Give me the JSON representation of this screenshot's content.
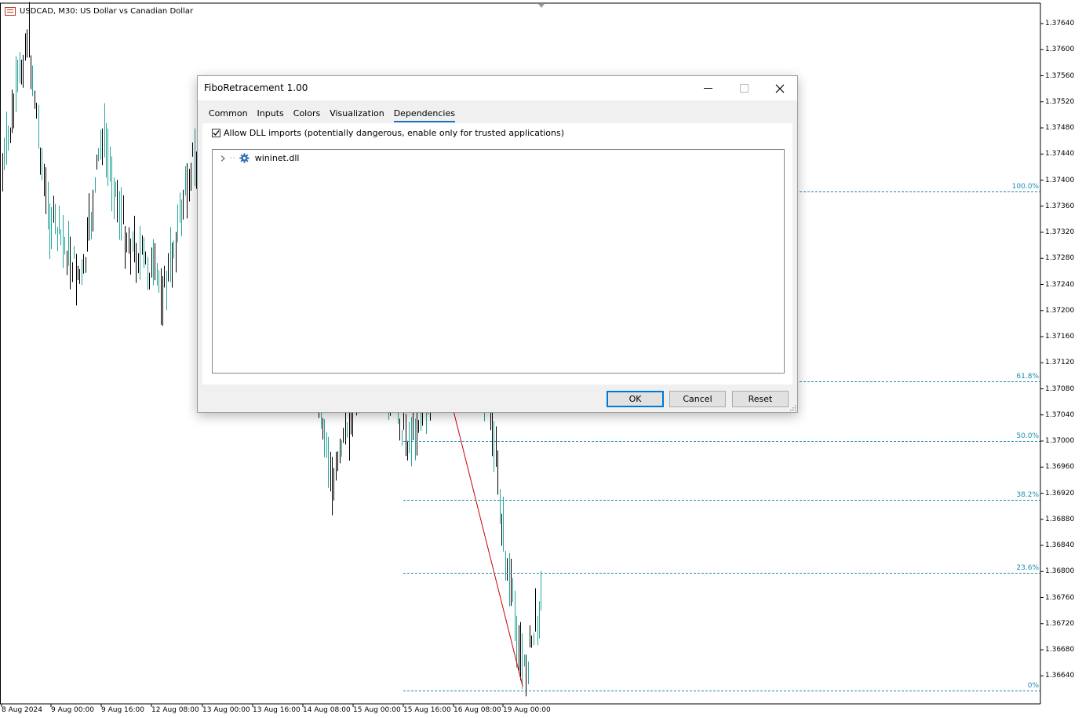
{
  "chart": {
    "title": "USDCAD, M30:  US Dollar vs Canadian Dollar",
    "icon": "chart-window-icon",
    "price_axis": [
      "1.37640",
      "1.37600",
      "1.37560",
      "1.37520",
      "1.37480",
      "1.37440",
      "1.37400",
      "1.37360",
      "1.37320",
      "1.37280",
      "1.37240",
      "1.37200",
      "1.37160",
      "1.37120",
      "1.37080",
      "1.37040",
      "1.37000",
      "1.36960",
      "1.36920",
      "1.36880",
      "1.36840",
      "1.36800",
      "1.36760",
      "1.36720",
      "1.36680",
      "1.36640"
    ],
    "time_axis": [
      "8 Aug 2024",
      "9 Aug 00:00",
      "9 Aug 16:00",
      "12 Aug 08:00",
      "13 Aug 00:00",
      "13 Aug 16:00",
      "14 Aug 08:00",
      "15 Aug 00:00",
      "15 Aug 16:00",
      "16 Aug 08:00",
      "19 Aug 00:00"
    ],
    "fibo_levels": [
      {
        "label": "100.0%",
        "price": 1.37383
      },
      {
        "label": "61.8%",
        "price": 1.37091
      },
      {
        "label": "50.0%",
        "price": 1.37
      },
      {
        "label": "38.2%",
        "price": 1.3691
      },
      {
        "label": "23.6%",
        "price": 1.36798
      },
      {
        "label": "0%",
        "price": 1.36617
      }
    ],
    "colors": {
      "bull": "#26a69a",
      "bear": "#000000",
      "fibo": "#1a8bb0",
      "trend": "#cc0000"
    }
  },
  "dialog": {
    "title": "FiboRetracement 1.00",
    "tabs": [
      {
        "label": "Common"
      },
      {
        "label": "Inputs"
      },
      {
        "label": "Colors"
      },
      {
        "label": "Visualization"
      },
      {
        "label": "Dependencies",
        "active": true
      }
    ],
    "allow_dll_label": "Allow DLL imports (potentially dangerous, enable only for trusted applications)",
    "allow_dll_checked": true,
    "dependencies": [
      {
        "name": "wininet.dll"
      }
    ],
    "buttons": {
      "ok": "OK",
      "cancel": "Cancel",
      "reset": "Reset"
    }
  }
}
